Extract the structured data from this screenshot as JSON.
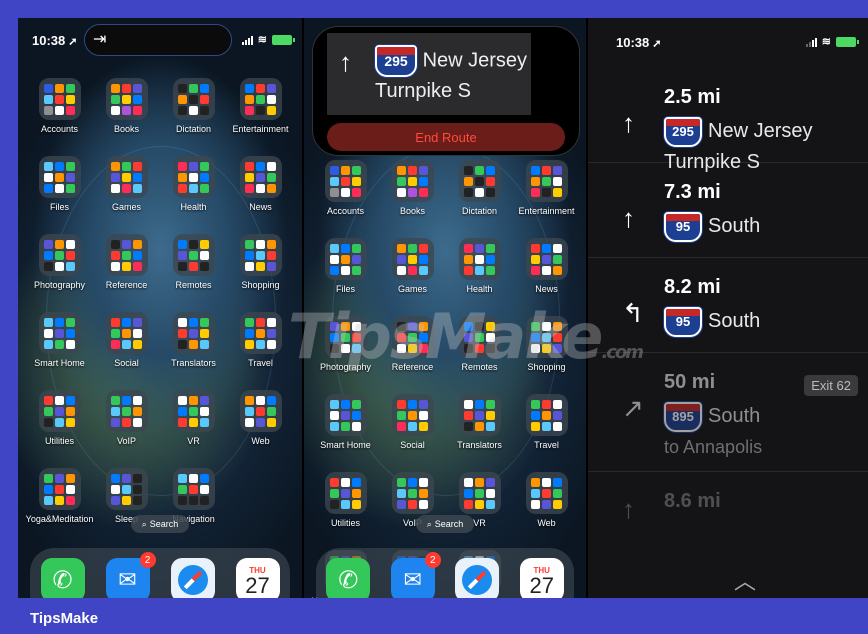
{
  "brand": "TipsMake",
  "watermark": {
    "main": "TipsMake",
    "suffix": ".com"
  },
  "colors": {
    "frame": "#3f45c5",
    "end_route_bg": "#6a1d19",
    "end_route_text": "#ff4a3d",
    "shield_blue": "#1d3f91",
    "shield_red": "#c62828"
  },
  "status": {
    "time": "10:38"
  },
  "home": {
    "folders": [
      {
        "label": "Accounts",
        "colors": [
          "#2d5be3",
          "#ff9500",
          "#34c759",
          "#5ac8fa",
          "#ff3b30",
          "#ffcc00",
          "#8e8e93",
          "#fff",
          "#ff2d55"
        ]
      },
      {
        "label": "Books",
        "colors": [
          "#ff9500",
          "#ff3b30",
          "#5856d6",
          "#34c759",
          "#ffcc00",
          "#007aff",
          "#fff",
          "#af52de",
          "#ff2d55"
        ]
      },
      {
        "label": "Dictation",
        "colors": [
          "#222",
          "#34c759",
          "#007aff",
          "#ff9500",
          "#222",
          "#ff3b30",
          "#222",
          "#fff",
          "#222"
        ]
      },
      {
        "label": "Entertainment",
        "colors": [
          "#007aff",
          "#ff3b30",
          "#5856d6",
          "#ff9500",
          "#34c759",
          "#fff",
          "#ff2d55",
          "#222",
          "#ffcc00"
        ]
      },
      {
        "label": "Files",
        "colors": [
          "#5ac8fa",
          "#007aff",
          "#34c759",
          "#fff",
          "#ff9500",
          "#5856d6",
          "#007aff",
          "#fff",
          "#34c759"
        ]
      },
      {
        "label": "Games",
        "colors": [
          "#ff9500",
          "#34c759",
          "#ff3b30",
          "#5856d6",
          "#ffcc00",
          "#007aff",
          "#fff",
          "#ff2d55",
          "#5ac8fa"
        ]
      },
      {
        "label": "Health",
        "colors": [
          "#ff2d55",
          "#5856d6",
          "#34c759",
          "#ff9500",
          "#fff",
          "#007aff",
          "#ff3b30",
          "#5ac8fa",
          "#34c759"
        ]
      },
      {
        "label": "News",
        "colors": [
          "#ff3b30",
          "#007aff",
          "#fff",
          "#ffcc00",
          "#5856d6",
          "#34c759",
          "#ff2d55",
          "#fff",
          "#ff9500"
        ]
      },
      {
        "label": "Photography",
        "colors": [
          "#5856d6",
          "#ff9500",
          "#fff",
          "#007aff",
          "#34c759",
          "#ff3b30",
          "#222",
          "#fff",
          "#5ac8fa"
        ]
      },
      {
        "label": "Reference",
        "colors": [
          "#222",
          "#5856d6",
          "#ff9500",
          "#ff3b30",
          "#34c759",
          "#007aff",
          "#fff",
          "#ffcc00",
          "#ff2d55"
        ]
      },
      {
        "label": "Remotes",
        "colors": [
          "#007aff",
          "#222",
          "#ffcc00",
          "#5856d6",
          "#34c759",
          "#fff",
          "#222",
          "#ff3b30",
          "#222"
        ]
      },
      {
        "label": "Shopping",
        "colors": [
          "#34c759",
          "#fff",
          "#ff9500",
          "#007aff",
          "#5ac8fa",
          "#ff3b30",
          "#fff",
          "#ffcc00",
          "#5856d6"
        ]
      },
      {
        "label": "Smart Home",
        "colors": [
          "#5ac8fa",
          "#007aff",
          "#34c759",
          "#fff",
          "#5856d6",
          "#007aff",
          "#5ac8fa",
          "#34c759",
          "#fff"
        ]
      },
      {
        "label": "Social",
        "colors": [
          "#ff3b30",
          "#007aff",
          "#5856d6",
          "#34c759",
          "#ff9500",
          "#fff",
          "#ff2d55",
          "#5ac8fa",
          "#ffcc00"
        ]
      },
      {
        "label": "Translators",
        "colors": [
          "#fff",
          "#007aff",
          "#34c759",
          "#ff3b30",
          "#5856d6",
          "#ffcc00",
          "#222",
          "#ff9500",
          "#5ac8fa"
        ]
      },
      {
        "label": "Travel",
        "colors": [
          "#34c759",
          "#ff3b30",
          "#fff",
          "#007aff",
          "#ff9500",
          "#5856d6",
          "#ffcc00",
          "#5ac8fa",
          "#fff"
        ]
      },
      {
        "label": "Utilities",
        "colors": [
          "#ff3b30",
          "#fff",
          "#007aff",
          "#34c759",
          "#5856d6",
          "#ff9500",
          "#222",
          "#5ac8fa",
          "#ffcc00"
        ]
      },
      {
        "label": "VoIP",
        "colors": [
          "#34c759",
          "#007aff",
          "#fff",
          "#5ac8fa",
          "#34c759",
          "#ff9500",
          "#5856d6",
          "#ff3b30",
          "#fff"
        ]
      },
      {
        "label": "VR",
        "colors": [
          "#fff",
          "#ff9500",
          "#5856d6",
          "#007aff",
          "#34c759",
          "#fff",
          "#ff3b30",
          "#ffcc00",
          "#5ac8fa"
        ]
      },
      {
        "label": "Web",
        "colors": [
          "#ff9500",
          "#fff",
          "#007aff",
          "#5ac8fa",
          "#ff3b30",
          "#34c759",
          "#fff",
          "#5856d6",
          "#ffcc00"
        ]
      },
      {
        "label": "Yoga&Meditation",
        "colors": [
          "#34c759",
          "#5856d6",
          "#ff9500",
          "#007aff",
          "#ff3b30",
          "#fff",
          "#5ac8fa",
          "#ffcc00",
          "#ff2d55"
        ]
      },
      {
        "label": "Sleep",
        "colors": [
          "#007aff",
          "#5856d6",
          "#222",
          "#fff",
          "#5ac8fa",
          "#222",
          "#5856d6",
          "#ffcc00",
          "#222"
        ]
      },
      {
        "label": "Navigation",
        "colors": [
          "#5ac8fa",
          "#fff",
          "#007aff",
          "#34c759",
          "#ff3b30",
          "#fff",
          "#222",
          "#222",
          "#222"
        ]
      }
    ],
    "search_label": "Search",
    "dock": {
      "mail_badge": "2",
      "calendar_day": "THU",
      "calendar_date": "27"
    }
  },
  "nav_banner": {
    "route_number": "295",
    "route_name": "New Jersey Turnpike S",
    "end_route": "End Route"
  },
  "directions": [
    {
      "distance": "2.5 mi",
      "route": "295",
      "road": "New Jersey Turnpike S",
      "arrow": "↑"
    },
    {
      "distance": "7.3 mi",
      "route": "95",
      "road": "South",
      "arrow": "↑"
    },
    {
      "distance": "8.2 mi",
      "route": "95",
      "road": "South",
      "arrow": "↰"
    },
    {
      "distance": "50 mi",
      "route": "895",
      "road": "South",
      "to": "to Annapolis",
      "exit": "Exit 62",
      "arrow": "↗"
    },
    {
      "distance": "8.6 mi",
      "arrow": "↑"
    }
  ]
}
